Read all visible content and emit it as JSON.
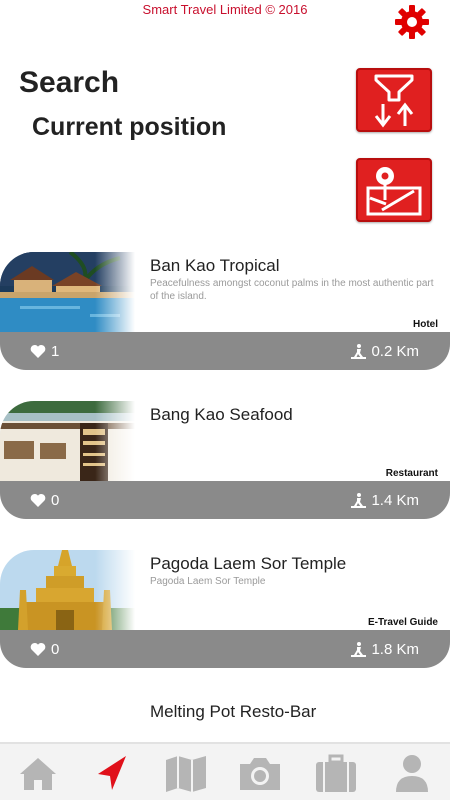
{
  "header": {
    "copyright": "Smart Travel Limited © 2016",
    "settings_icon": "gear-icon"
  },
  "titles": {
    "search": "Search",
    "position": "Current position"
  },
  "actions": {
    "filter_icon": "funnel-sort-icon",
    "map_icon": "map-pin-icon",
    "color": "#e02020"
  },
  "places": [
    {
      "title": "Ban Kao Tropical",
      "description": "Peacefulness amongst coconut palms in the most authentic part of the island.",
      "category": "Hotel",
      "likes": "1",
      "distance": "0.2 Km"
    },
    {
      "title": "Bang Kao Seafood",
      "description": "",
      "category": "Restaurant",
      "likes": "0",
      "distance": "1.4 Km"
    },
    {
      "title": "Pagoda Laem Sor Temple",
      "description": "Pagoda Laem Sor Temple",
      "category": "E-Travel Guide",
      "likes": "0",
      "distance": "1.8 Km"
    },
    {
      "title": "Melting Pot Resto-Bar"
    }
  ],
  "nav": {
    "items": [
      "home-icon",
      "location-arrow-icon",
      "map-icon",
      "camera-icon",
      "suitcase-icon",
      "user-icon"
    ],
    "active_color": "#e0101a",
    "inactive_color": "#b5b5b5"
  },
  "colors": {
    "brand_red": "#c8102e",
    "bar_gray": "#8a8a8a"
  }
}
